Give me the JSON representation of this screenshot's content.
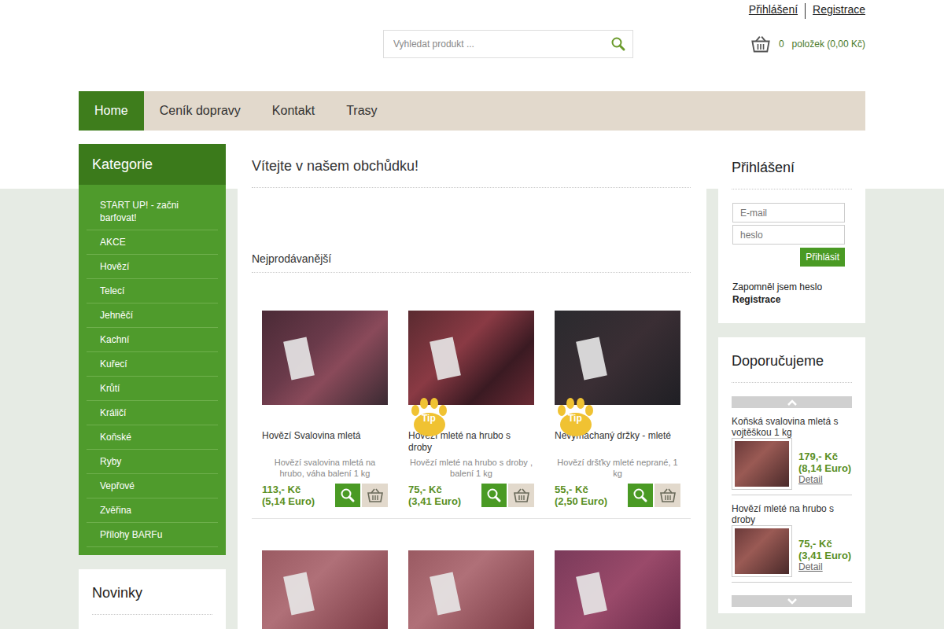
{
  "header": {
    "links": [
      "Přihlášení",
      "Registrace"
    ],
    "search": {
      "placeholder": "Vyhledat produkt ..."
    },
    "cart": {
      "count": "0",
      "label": "položek (0,00 Kč)"
    }
  },
  "nav": [
    {
      "label": "Home",
      "selected": true
    },
    {
      "label": "Ceník dopravy",
      "selected": false
    },
    {
      "label": "Kontakt",
      "selected": false
    },
    {
      "label": "Trasy",
      "selected": false
    }
  ],
  "categories": {
    "title": "Kategorie",
    "items": [
      "START UP! - začni barfovat!",
      "AKCE",
      "Hovězí",
      "Telecí",
      "Jehněčí",
      "Kachní",
      "Kuřecí",
      "Krůtí",
      "Králičí",
      "Koňské",
      "Ryby",
      "Vepřové",
      "Zvěřina",
      "Přílohy BARFu"
    ]
  },
  "novinky": {
    "title": "Novinky"
  },
  "main": {
    "title": "Vítejte v našem obchůdku!",
    "section": "Nejprodávanější",
    "products": [
      {
        "kind": "full",
        "name": "Hovězí Svalovina mletá",
        "desc": "Hovězí svalovina mletá na hrubo, váha balení 1 kg",
        "price": "113,- Kč",
        "euro": "(5,14 Euro)",
        "tip": false
      },
      {
        "kind": "full",
        "name": "Hovězí mleté na hrubo s droby",
        "desc": "Hovězí mleté na hrubo s droby , balení 1 kg",
        "price": "75,- Kč",
        "euro": "(3,41 Euro)",
        "tip": true,
        "badge": "Tip"
      },
      {
        "kind": "full",
        "name": "Nevymáchaný držky - mleté",
        "desc": "Hovězí dršťky mleté neprané, 1 kg",
        "price": "55,- Kč",
        "euro": "(2,50 Euro)",
        "tip": true,
        "badge": "Tip"
      },
      {
        "kind": "image",
        "tip": false
      },
      {
        "kind": "image",
        "tip": false
      },
      {
        "kind": "image",
        "tip": false
      }
    ]
  },
  "login": {
    "title": "Přihlášení",
    "email_placeholder": "E-mail",
    "password_placeholder": "heslo",
    "button": "Přihlásit",
    "forgot": "Zapomněl jsem heslo",
    "register": "Registrace"
  },
  "recommended": {
    "title": "Doporučujeme",
    "items": [
      {
        "name": "Koňská svalovina mletá s vojtěškou 1 kg",
        "price": "179,- Kč",
        "euro": "(8,14 Euro)",
        "link": "Detail"
      },
      {
        "name": "Hovězí mleté na hrubo s droby",
        "price": "75,- Kč",
        "euro": "(3,41 Euro)",
        "link": "Detail"
      }
    ]
  }
}
